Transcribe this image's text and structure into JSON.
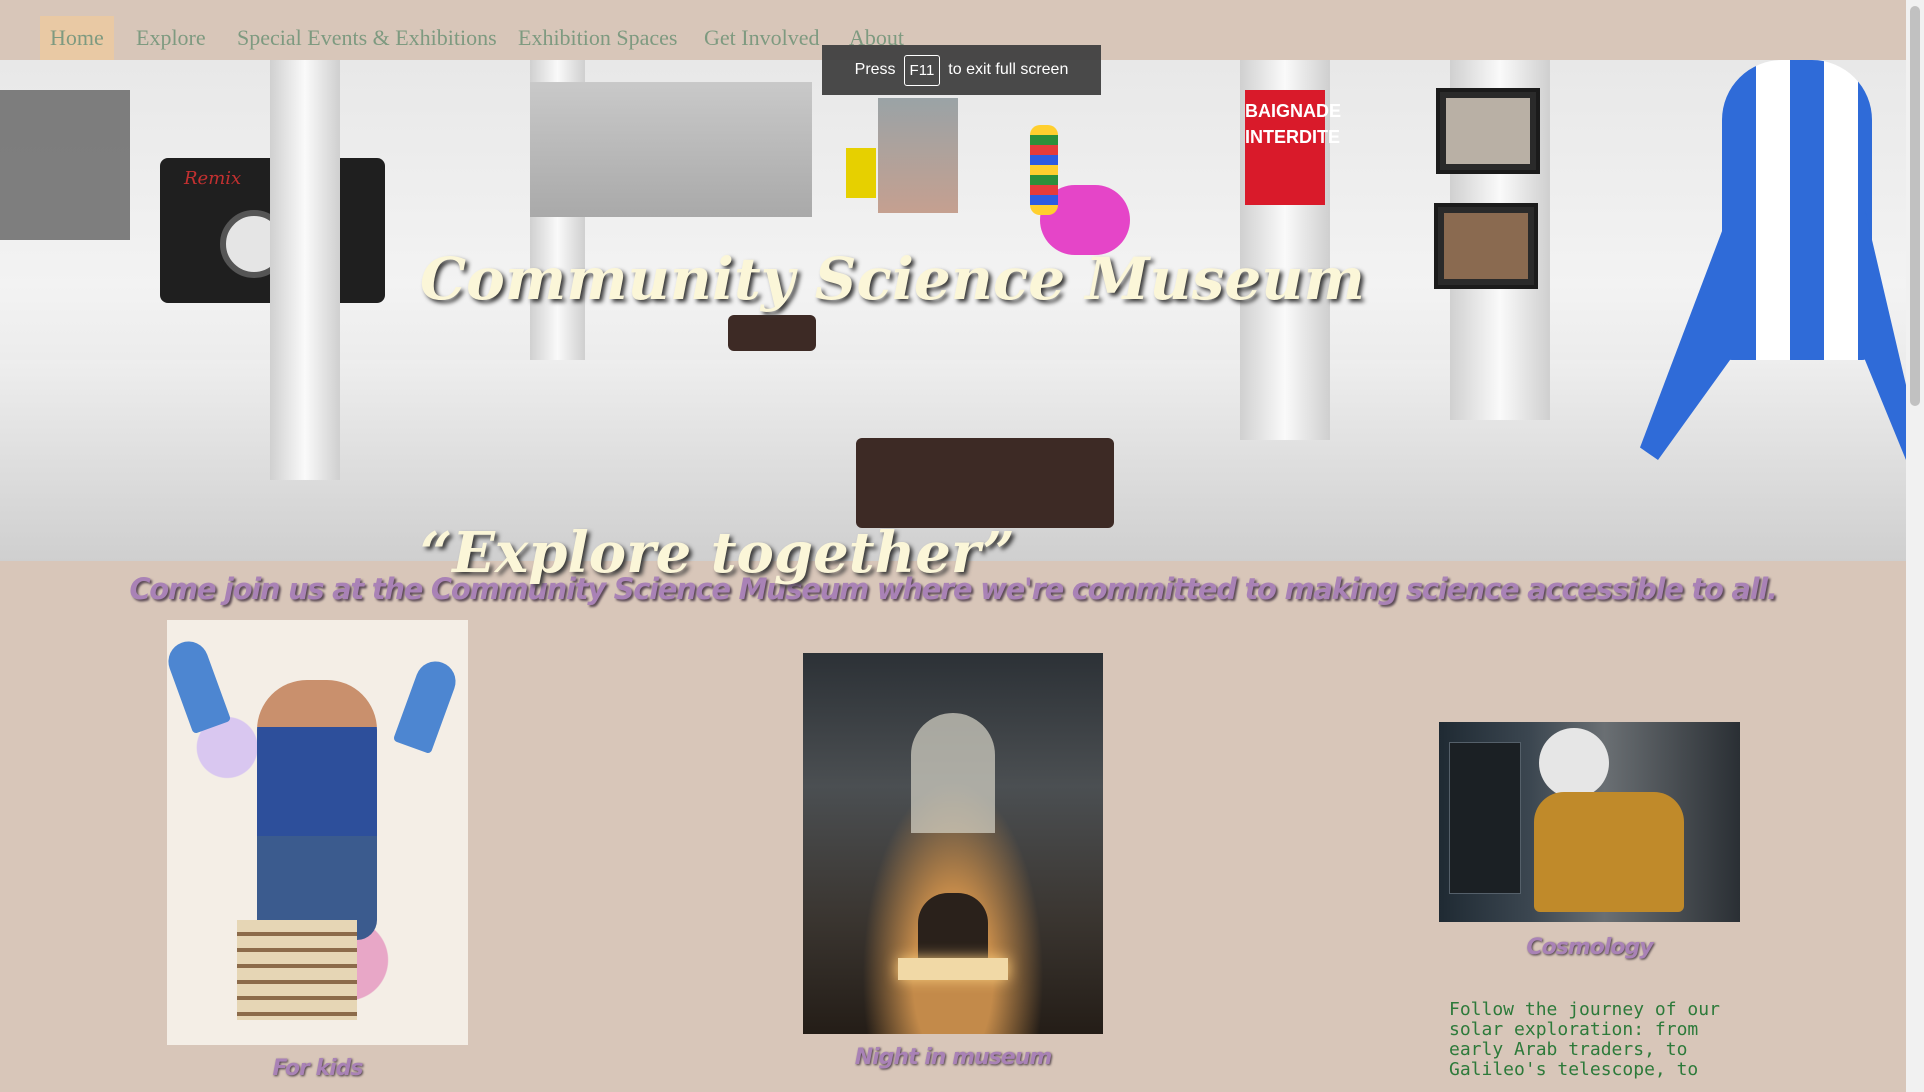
{
  "nav": {
    "items": [
      {
        "label": "Home",
        "active": true
      },
      {
        "label": "Explore",
        "active": false
      },
      {
        "label": "Special Events & Exhibitions",
        "active": false
      },
      {
        "label": "Exhibition Spaces",
        "active": false
      },
      {
        "label": "Get Involved",
        "active": false
      },
      {
        "label": "About",
        "active": false
      }
    ]
  },
  "fullscreen_notice": {
    "press": "Press",
    "key": "F11",
    "rest": "to exit full screen"
  },
  "hero": {
    "title": "Community Science Museum",
    "tagline": "“Explore together”",
    "sign_text": "BAIGNADE INTERDITE",
    "cassette_label": "Remix"
  },
  "intro": "Come join us at the Community Science Museum where we're committed to making science accessible to all.",
  "cards": [
    {
      "caption": "For kids"
    },
    {
      "caption": "Night in museum"
    },
    {
      "caption": "Cosmology",
      "description": "Follow the journey of our\nsolar exploration: from\nearly Arab traders, to\nGalileo's telescope, to"
    }
  ],
  "colors": {
    "page_bg": "#d8c6b9",
    "nav_text": "#7e9a80",
    "nav_active_bg": "#e9c9a4",
    "title_text": "#fbf6d8",
    "caption_text": "#a982b6",
    "description_text": "#2d7a3a"
  }
}
